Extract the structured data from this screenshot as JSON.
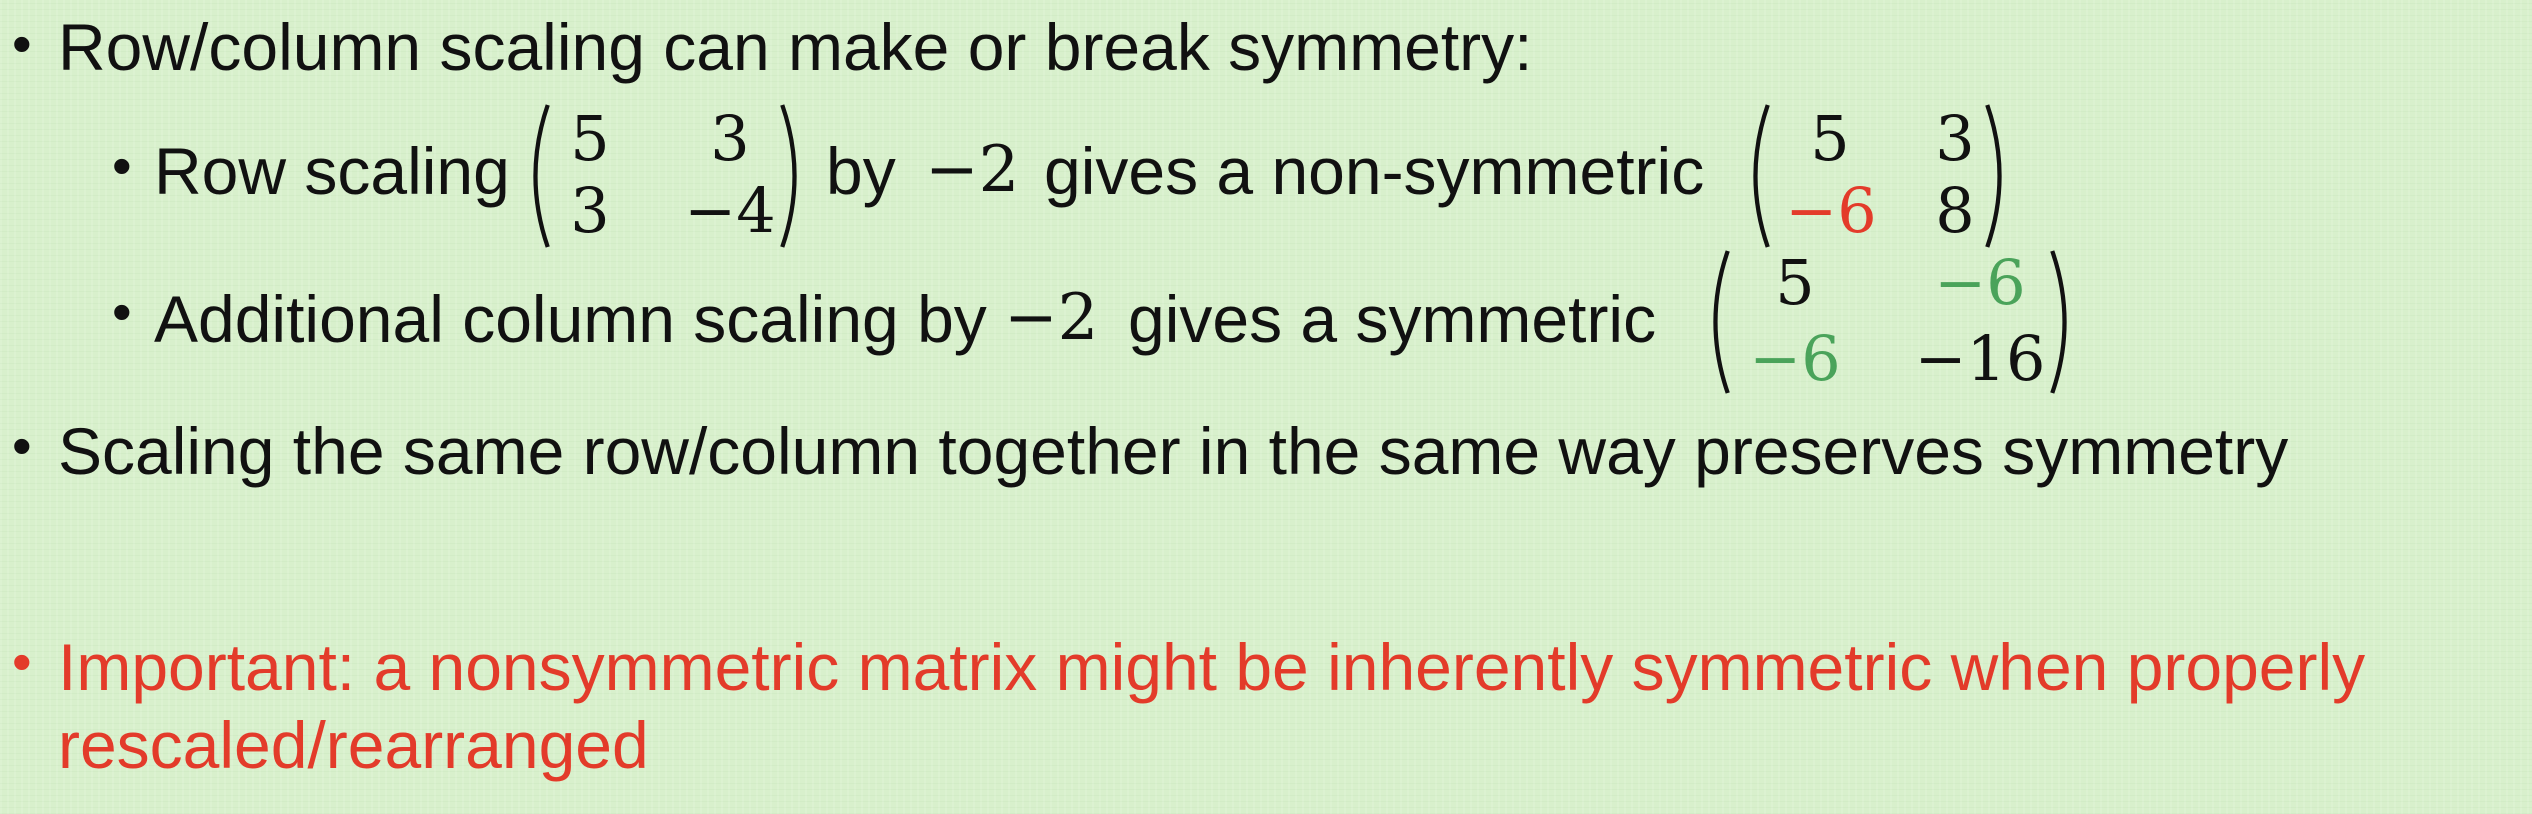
{
  "bullets": {
    "b1": {
      "text": "Row/column scaling can make or break symmetry:",
      "sub1": {
        "prefix": "Row scaling",
        "by": "by",
        "factor": "−2",
        "suffix": "gives a non-symmetric",
        "matrix_a": {
          "r1c1": "5",
          "r1c2": "3",
          "r2c1": "3",
          "r2c2": "−4"
        },
        "matrix_b": {
          "r1c1": "5",
          "r1c2": "3",
          "r2c1": "−6",
          "r2c2": "8"
        }
      },
      "sub2": {
        "prefix": "Additional column scaling by",
        "factor": "−2",
        "suffix": "gives a symmetric",
        "matrix_c": {
          "r1c1": "5",
          "r1c2": "−6",
          "r2c1": "−6",
          "r2c2": "−16"
        }
      }
    },
    "b2": {
      "text": "Scaling the same row/column together in the same way preserves symmetry"
    },
    "b3": {
      "line1": "Important: a nonsymmetric matrix might be inherently symmetric when properly",
      "line2": "rescaled/rearranged"
    }
  },
  "colors": {
    "highlight_red": "#e33b2a",
    "highlight_green": "#4aa35a",
    "text": "#111111",
    "background": "#d8f0cc"
  }
}
